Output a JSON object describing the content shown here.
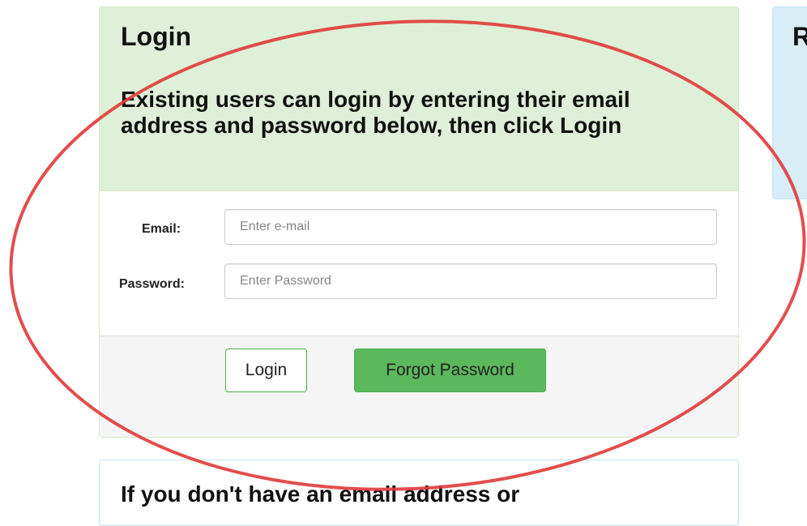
{
  "login_panel": {
    "title": "Login",
    "instructions": "Existing users can login by entering their email address and password below, then click Login",
    "email": {
      "label": "Email:",
      "placeholder": "Enter e-mail",
      "value": ""
    },
    "password": {
      "label": "Password:",
      "placeholder": "Enter Password",
      "value": ""
    },
    "buttons": {
      "login": "Login",
      "forgot_password": "Forgot Password"
    }
  },
  "register_panel": {
    "title": "R"
  },
  "info_panel": {
    "text": "If you don't have an email address or"
  },
  "colors": {
    "success_bg": "#dff0d8",
    "success_border": "#d6e9c6",
    "button_green": "#5cb85c",
    "info_bg": "#d9edf7",
    "annotation_red": "#e03a3a"
  },
  "annotation": {
    "shape": "ellipse",
    "color": "red"
  }
}
